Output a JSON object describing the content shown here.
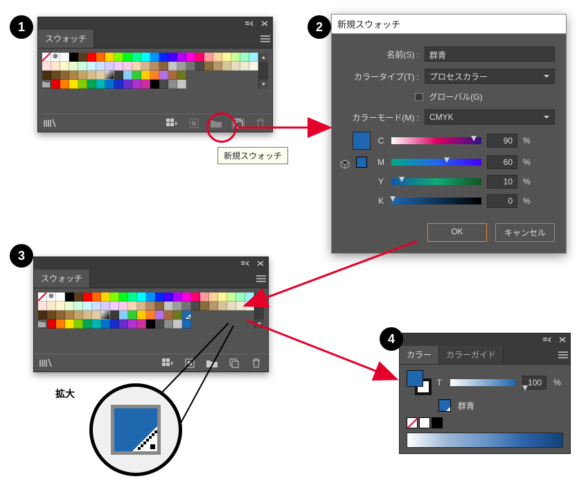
{
  "steps": {
    "s1": "1",
    "s2": "2",
    "s3": "3",
    "s4": "4"
  },
  "swatch_panel": {
    "title": "スウォッチ",
    "tooltip": "新規スウォッチ"
  },
  "dialog": {
    "title": "新規スウォッチ",
    "name_label": "名前(S) :",
    "name_value": "群青",
    "type_label": "カラータイプ(T) :",
    "type_value": "プロセスカラー",
    "global_label": "グローバル(G)",
    "mode_label": "カラーモード(M) :",
    "mode_value": "CMYK",
    "channels": {
      "C": {
        "label": "C",
        "value": "90"
      },
      "M": {
        "label": "M",
        "value": "60"
      },
      "Y": {
        "label": "Y",
        "value": "10"
      },
      "K": {
        "label": "K",
        "value": "0"
      }
    },
    "pct": "%",
    "ok": "OK",
    "cancel": "キャンセル"
  },
  "color_panel": {
    "tab1": "カラー",
    "tab2": "カラーガイド",
    "t_label": "T",
    "t_value": "100",
    "pct": "%",
    "swatch_name": "群青"
  },
  "magnify": {
    "label": "拡大"
  },
  "swatch_rows": {
    "r1": [
      "none",
      "reg",
      "#ffffff",
      "#000000",
      "#5a3b1e",
      "#ff0000",
      "#ff6a00",
      "#ffd800",
      "#7fff00",
      "#00ff21",
      "#00ff90",
      "#00ffff",
      "#0094ff",
      "#0026ff",
      "#4800ff",
      "#b200ff",
      "#ff00dc",
      "#ff006e",
      "#ff9a9a",
      "#ffd59a",
      "#fff79a",
      "#c8ff9a",
      "#9affc1",
      "#9af2ff"
    ],
    "r2": [
      "#ffe0e0",
      "#ffe9cc",
      "#fff7cc",
      "#e7ffcc",
      "#ccffe0",
      "#ccf7ff",
      "#cce0ff",
      "#d6ccff",
      "#f0ccff",
      "#ffcce8",
      "#f7d6b5",
      "#d6b58c",
      "#b58c63",
      "#8c633a",
      "#c6c6c6",
      "#9c9c9c",
      "#737373",
      "#4a4a4a",
      "#8a6d3b",
      "#b5976b",
      "#d6c49a",
      "#e8ddc0",
      "#f0ead4",
      "#faf6e8"
    ],
    "r3": [
      "#4a2e12",
      "#6b4a21",
      "#8c6633",
      "#ad844a",
      "#c6a56b",
      "#d6bc8c",
      "#e0cba5",
      "grad",
      "#3a3a3a",
      "#87cefa",
      "#32cd32",
      "#ffcc00",
      "#ff7f2a",
      "#b572e6",
      "#aa6a3e",
      "#6b7a1a"
    ],
    "r4": [
      "folder",
      "#e40000",
      "#ff7f00",
      "#ffe600",
      "#7fce00",
      "#00a651",
      "#00b5b5",
      "#0072ce",
      "#1a2ecf",
      "#6a2ecf",
      "#b52ecf",
      "#cf2e9e",
      "#000000",
      "#4a4a4a",
      "#8c8c8c",
      "#c6c6c6"
    ],
    "r4b": [
      "folder",
      "#e40000",
      "#ff7f00",
      "#ffe600",
      "#7fce00",
      "#00a651",
      "#00b5b5",
      "#0072ce",
      "#1a2ecf",
      "#6a2ecf",
      "#b52ecf",
      "#cf2e9e",
      "#000000",
      "#4a4a4a",
      "#8c8c8c",
      "#c6c6c6",
      "#1f68b0"
    ]
  }
}
